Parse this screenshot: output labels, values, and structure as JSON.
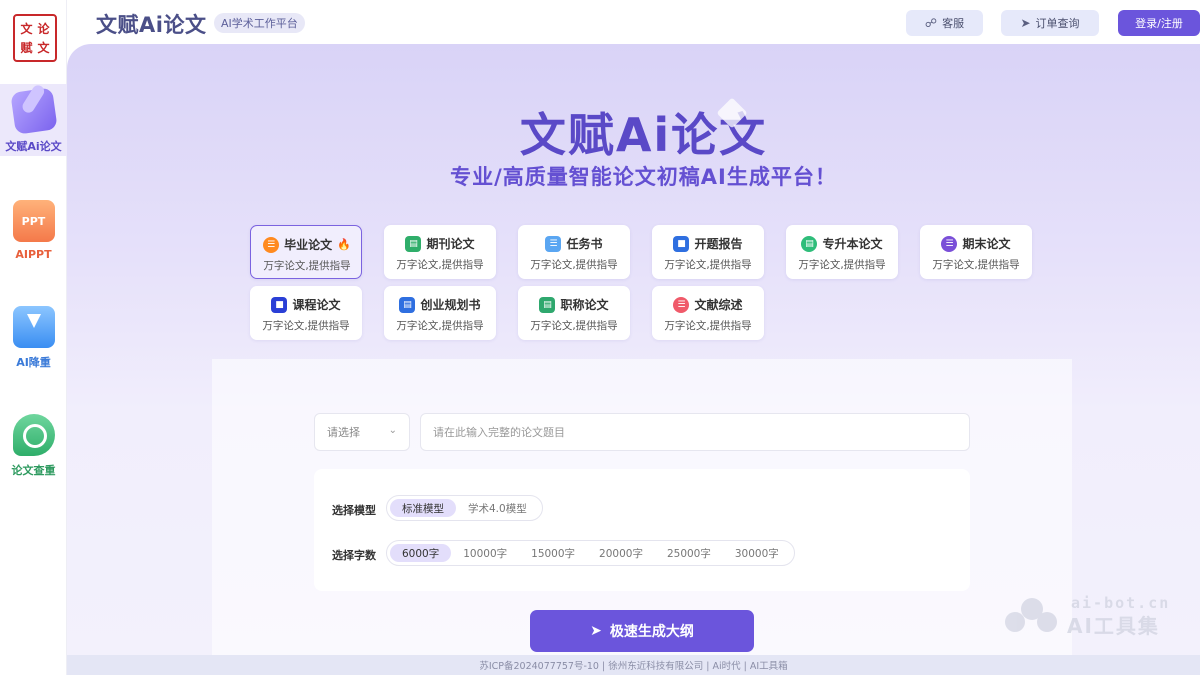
{
  "brand": {
    "logo_chars": [
      "文",
      "论",
      "赋",
      "文"
    ],
    "app_title": "文赋Ai论文",
    "tag": "AI学术工作平台"
  },
  "header": {
    "service_label": "客服",
    "order_label": "订单查询",
    "login_label": "登录/注册"
  },
  "sidebar": {
    "items": [
      {
        "label": "文赋Ai论文",
        "icon": "pen-icon",
        "color": "#5a49c7"
      },
      {
        "label": "AIPPT",
        "icon": "ppt-icon",
        "icon_text": "PPT",
        "color": "#e8603c"
      },
      {
        "label": "AI降重",
        "icon": "download-icon",
        "color": "#3a7ad8"
      },
      {
        "label": "论文查重",
        "icon": "magnifier-icon",
        "color": "#2e9a5f"
      }
    ]
  },
  "hero": {
    "title": "文赋Ai论文",
    "subtitle": "专业/高质量智能论文初稿AI生成平台！"
  },
  "paper_types": [
    {
      "name": "毕业论文",
      "desc": "万字论文,提供指导",
      "icon_color": "#ff8a1f",
      "hot": true
    },
    {
      "name": "期刊论文",
      "desc": "万字论文,提供指导",
      "icon_color": "#2fae6a"
    },
    {
      "name": "任务书",
      "desc": "万字论文,提供指导",
      "icon_color": "#5aa6f2"
    },
    {
      "name": "开题报告",
      "desc": "万字论文,提供指导",
      "icon_color": "#2f6fe0"
    },
    {
      "name": "专升本论文",
      "desc": "万字论文,提供指导",
      "icon_color": "#2fbd7a"
    },
    {
      "name": "期末论文",
      "desc": "万字论文,提供指导",
      "icon_color": "#7a4fd8"
    },
    {
      "name": "课程论文",
      "desc": "万字论文,提供指导",
      "icon_color": "#2a3fd6"
    },
    {
      "name": "创业规划书",
      "desc": "万字论文,提供指导",
      "icon_color": "#2f6fe0"
    },
    {
      "name": "职称论文",
      "desc": "万字论文,提供指导",
      "icon_color": "#2fa86e"
    },
    {
      "name": "文献综述",
      "desc": "万字论文,提供指导",
      "icon_color": "#f05a6a"
    }
  ],
  "form": {
    "select_placeholder": "请选择",
    "topic_placeholder": "请在此输入完整的论文题目",
    "model_label": "选择模型",
    "models": [
      "标准模型",
      "学术4.0模型"
    ],
    "selected_model": "标准模型",
    "words_label": "选择字数",
    "word_counts": [
      "6000字",
      "10000字",
      "15000字",
      "20000字",
      "25000字",
      "30000字"
    ],
    "selected_words": "6000字",
    "generate_label": "极速生成大纲"
  },
  "footer": {
    "text": "苏ICP备2024077757号-10 | 徐州东近科技有限公司 | Ai时代 | AI工具箱"
  },
  "watermark": {
    "url": "ai-bot.cn",
    "name": "AI工具集"
  }
}
